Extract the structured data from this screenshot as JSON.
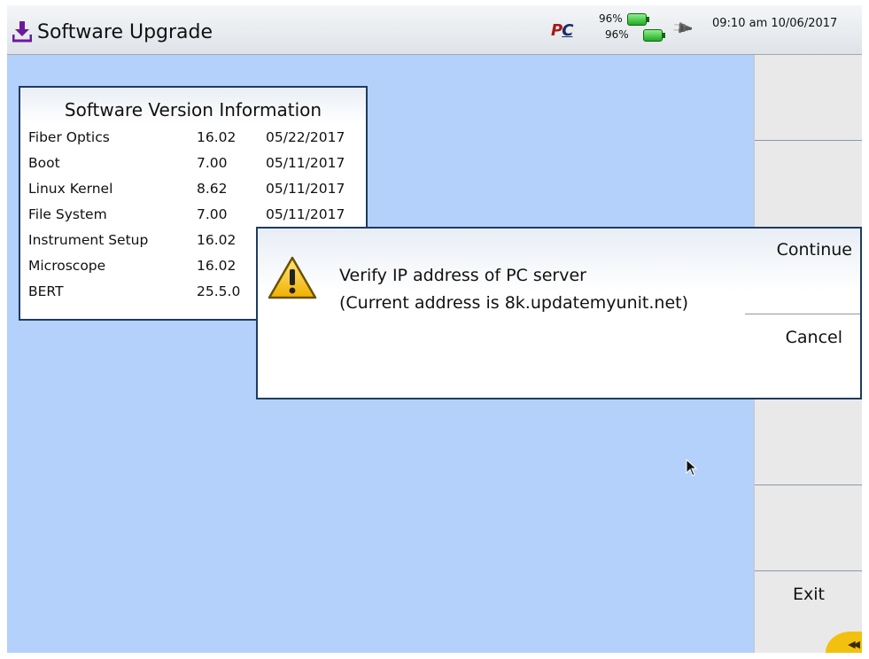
{
  "titlebar": {
    "title": "Software Upgrade",
    "logo_text_1": "P",
    "logo_text_2": "C",
    "battery1_pct": "96%",
    "battery2_pct": "96%",
    "clock": "09:10 am  10/06/2017"
  },
  "icons": {
    "title": "download-icon",
    "logo": "pc-logo-icon",
    "battery": "battery-icon",
    "power": "plug-icon",
    "warning": "warning-icon",
    "corner": "double-chevron-left-icon",
    "cursor": "mouse-pointer-icon"
  },
  "version_info": {
    "title": "Software Version Information",
    "rows": [
      {
        "name": "Fiber Optics",
        "version": "16.02",
        "date": "05/22/2017"
      },
      {
        "name": "Boot",
        "version": "7.00",
        "date": "05/11/2017"
      },
      {
        "name": "Linux Kernel",
        "version": "8.62",
        "date": "05/11/2017"
      },
      {
        "name": "File System",
        "version": "7.00",
        "date": "05/11/2017"
      },
      {
        "name": "Instrument Setup",
        "version": "16.02",
        "date": ""
      },
      {
        "name": "Microscope",
        "version": "16.02",
        "date": ""
      },
      {
        "name": "BERT",
        "version": "25.5.0",
        "date": ""
      }
    ]
  },
  "dialog": {
    "line1": "Verify IP address of PC server",
    "line2": "(Current address is 8k.updatemyunit.net)",
    "continue_label": "Continue",
    "cancel_label": "Cancel"
  },
  "side_panel": {
    "exit_label": "Exit"
  },
  "colors": {
    "background": "#b3d1fb",
    "border": "#1e3b62",
    "accent": "#f2c10f",
    "title_icon": "#6a1b9a"
  }
}
